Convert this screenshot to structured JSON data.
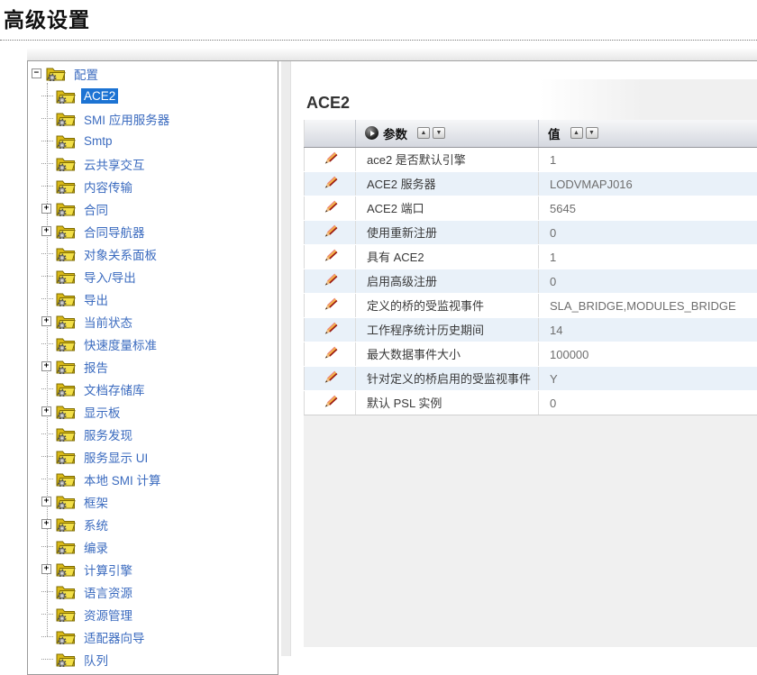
{
  "page": {
    "title": "高级设置"
  },
  "colors": {
    "accent_blue": "#1c73d3",
    "link_blue": "#3b6bbf",
    "row_alt_blue": "#e9f1f9",
    "folder_yellow": "#e8c922",
    "pencil_red": "#d53a2c"
  },
  "icons": {
    "sort_asc": "▲",
    "sort_desc": "▼",
    "collapse_glyph": "−",
    "expand_glyph": "+"
  },
  "tree": {
    "items": [
      {
        "label": "配置",
        "depth": 0,
        "expander": "minus",
        "selected": false
      },
      {
        "label": "ACE2",
        "depth": 1,
        "expander": "none",
        "selected": true
      },
      {
        "label": "SMI 应用服务器",
        "depth": 1,
        "expander": "none",
        "selected": false
      },
      {
        "label": "Smtp",
        "depth": 1,
        "expander": "none",
        "selected": false
      },
      {
        "label": "云共享交互",
        "depth": 1,
        "expander": "none",
        "selected": false
      },
      {
        "label": "内容传输",
        "depth": 1,
        "expander": "none",
        "selected": false
      },
      {
        "label": "合同",
        "depth": 1,
        "expander": "plus",
        "selected": false
      },
      {
        "label": "合同导航器",
        "depth": 1,
        "expander": "plus",
        "selected": false
      },
      {
        "label": "对象关系面板",
        "depth": 1,
        "expander": "none",
        "selected": false
      },
      {
        "label": "导入/导出",
        "depth": 1,
        "expander": "none",
        "selected": false
      },
      {
        "label": "导出",
        "depth": 1,
        "expander": "none",
        "selected": false
      },
      {
        "label": "当前状态",
        "depth": 1,
        "expander": "plus",
        "selected": false
      },
      {
        "label": "快速度量标准",
        "depth": 1,
        "expander": "none",
        "selected": false
      },
      {
        "label": "报告",
        "depth": 1,
        "expander": "plus",
        "selected": false
      },
      {
        "label": "文档存储库",
        "depth": 1,
        "expander": "none",
        "selected": false
      },
      {
        "label": "显示板",
        "depth": 1,
        "expander": "plus",
        "selected": false
      },
      {
        "label": "服务发现",
        "depth": 1,
        "expander": "none",
        "selected": false
      },
      {
        "label": "服务显示 UI",
        "depth": 1,
        "expander": "none",
        "selected": false
      },
      {
        "label": "本地 SMI 计算",
        "depth": 1,
        "expander": "none",
        "selected": false
      },
      {
        "label": "框架",
        "depth": 1,
        "expander": "plus",
        "selected": false
      },
      {
        "label": "系统",
        "depth": 1,
        "expander": "plus",
        "selected": false
      },
      {
        "label": "编录",
        "depth": 1,
        "expander": "none",
        "selected": false
      },
      {
        "label": "计算引擎",
        "depth": 1,
        "expander": "plus",
        "selected": false
      },
      {
        "label": "语言资源",
        "depth": 1,
        "expander": "none",
        "selected": false
      },
      {
        "label": "资源管理",
        "depth": 1,
        "expander": "none",
        "selected": false
      },
      {
        "label": "适配器向导",
        "depth": 1,
        "expander": "none",
        "selected": false
      },
      {
        "label": "队列",
        "depth": 1,
        "expander": "none",
        "selected": false
      }
    ]
  },
  "content": {
    "heading": "ACE2",
    "table": {
      "param_header": "参数",
      "value_header": "值",
      "rows": [
        {
          "param": "ace2 是否默认引擎",
          "value": "1"
        },
        {
          "param": "ACE2 服务器",
          "value": "LODVMAPJ016"
        },
        {
          "param": "ACE2 端口",
          "value": "5645"
        },
        {
          "param": "使用重新注册",
          "value": "0"
        },
        {
          "param": "具有  ACE2",
          "value": "1"
        },
        {
          "param": "启用高级注册",
          "value": "0"
        },
        {
          "param": "定义的桥的受监视事件",
          "value": "SLA_BRIDGE,MODULES_BRIDGE"
        },
        {
          "param": "工作程序统计历史期间",
          "value": "14"
        },
        {
          "param": "最大数据事件大小",
          "value": "100000"
        },
        {
          "param": "针对定义的桥启用的受监视事件",
          "value": "Y"
        },
        {
          "param": "默认  PSL 实例",
          "value": "0"
        }
      ]
    }
  }
}
